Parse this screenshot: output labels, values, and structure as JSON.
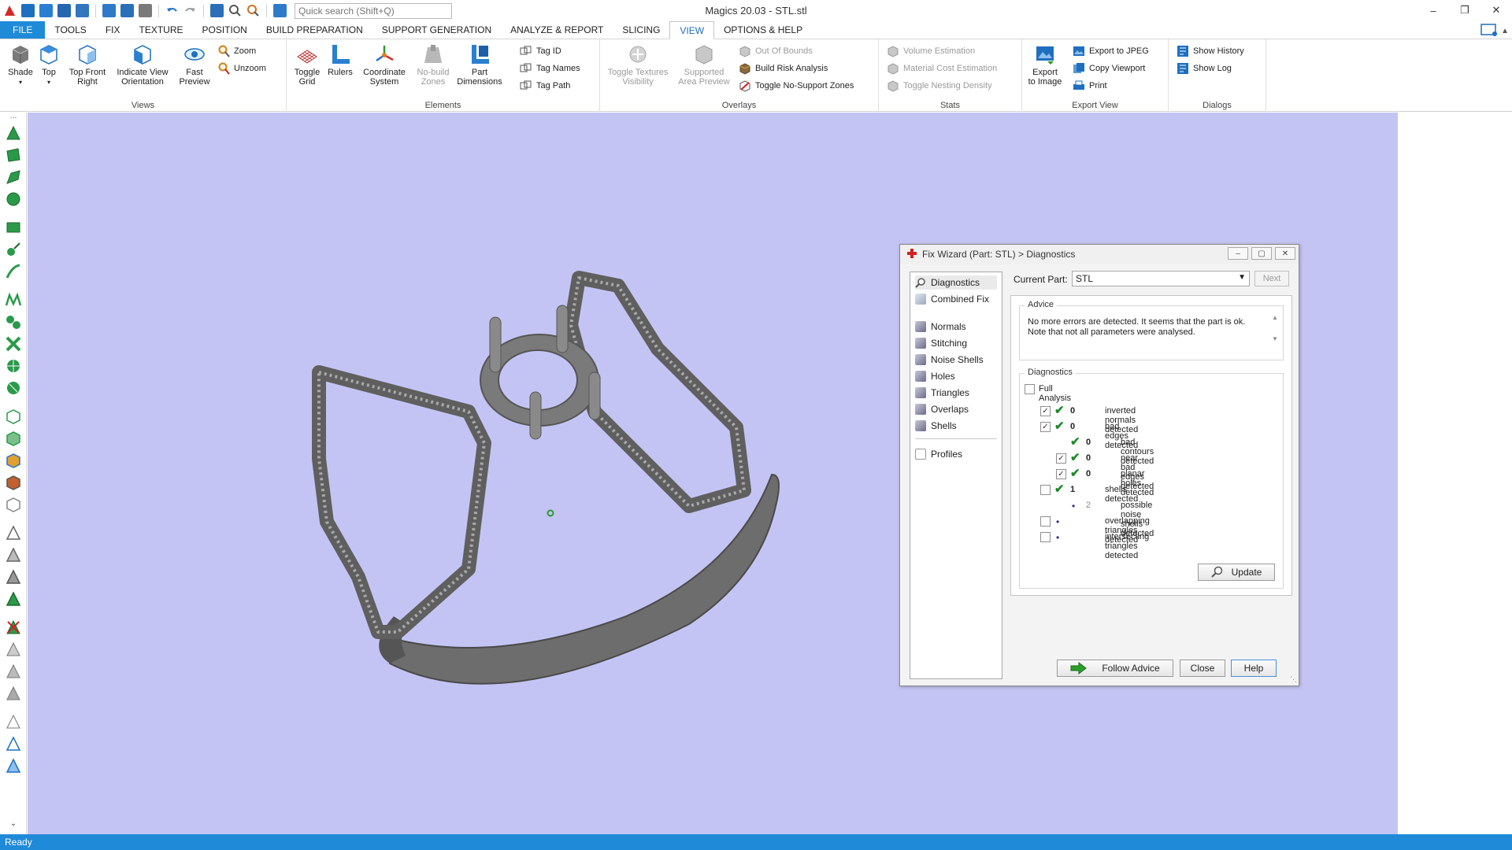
{
  "window": {
    "title": "Magics 20.03 - STL.stl"
  },
  "quick_search": {
    "placeholder": "Quick search (Shift+Q)"
  },
  "menu": {
    "items": [
      "FILE",
      "TOOLS",
      "FIX",
      "TEXTURE",
      "POSITION",
      "BUILD PREPARATION",
      "SUPPORT GENERATION",
      "ANALYZE & REPORT",
      "SLICING",
      "VIEW",
      "OPTIONS & HELP"
    ],
    "active": "VIEW"
  },
  "ribbon": {
    "views": {
      "label": "Views",
      "shade": "Shade",
      "top": "Top",
      "top_front_right": "Top Front\nRight",
      "indicate_view": "Indicate View\nOrientation",
      "fast_preview": "Fast\nPreview",
      "zoom": "Zoom",
      "unzoom": "Unzoom"
    },
    "elements": {
      "label": "Elements",
      "toggle_grid": "Toggle\nGrid",
      "rulers": "Rulers",
      "coordinate_system": "Coordinate\nSystem",
      "no_build_zones": "No-build\nZones",
      "part_dimensions": "Part\nDimensions",
      "tag_id": "Tag ID",
      "tag_names": "Tag Names",
      "tag_path": "Tag Path"
    },
    "overlays": {
      "label": "Overlays",
      "toggle_textures": "Toggle Textures\nVisibility",
      "supported_area": "Supported\nArea Preview",
      "out_of_bounds": "Out Of Bounds",
      "build_risk": "Build Risk Analysis",
      "toggle_no_support": "Toggle No-Support Zones"
    },
    "stats": {
      "label": "Stats",
      "volume": "Volume Estimation",
      "material_cost": "Material Cost Estimation",
      "nesting_density": "Toggle Nesting Density"
    },
    "export_view": {
      "label": "Export View",
      "export_to_image": "Export\nto Image",
      "export_jpeg": "Export to JPEG",
      "copy_viewport": "Copy Viewport",
      "print": "Print"
    },
    "dialogs": {
      "label": "Dialogs",
      "show_history": "Show History",
      "show_log": "Show Log"
    }
  },
  "status": {
    "text": "Ready"
  },
  "fix_wizard": {
    "title": "Fix Wizard (Part: STL) > Diagnostics",
    "nav": [
      "Diagnostics",
      "Combined Fix",
      "Normals",
      "Stitching",
      "Noise Shells",
      "Holes",
      "Triangles",
      "Overlaps",
      "Shells",
      "Profiles"
    ],
    "selected_nav": "Diagnostics",
    "current_part_label": "Current Part:",
    "current_part_value": "STL",
    "next_label": "Next",
    "advice_label": "Advice",
    "advice_text": "No more errors are detected. It seems that the part is ok. Note that not all parameters were analysed.",
    "diagnostics_label": "Diagnostics",
    "full_analysis_label": "Full Analysis",
    "rows": [
      {
        "checked": true,
        "status": "ok",
        "count": "0",
        "label": "inverted normals detected",
        "indent": 0
      },
      {
        "checked": true,
        "status": "ok",
        "count": "0",
        "label": "bad edges detected",
        "indent": 0
      },
      {
        "checked": null,
        "status": "ok",
        "count": "0",
        "label": "bad contours detected",
        "indent": 1
      },
      {
        "checked": true,
        "status": "ok",
        "count": "0",
        "label": "near bad edges detected",
        "indent": 1
      },
      {
        "checked": true,
        "status": "ok",
        "count": "0",
        "label": "planar holes detected",
        "indent": 1
      },
      {
        "checked": false,
        "status": "ok",
        "count": "1",
        "label": "shells detected",
        "indent": 0
      },
      {
        "checked": null,
        "status": "info",
        "count": "2",
        "label": "possible noise shells detected",
        "indent": 1
      },
      {
        "checked": false,
        "status": "info",
        "count": "",
        "label": "overlapping triangles detected",
        "indent": 0
      },
      {
        "checked": false,
        "status": "info",
        "count": "",
        "label": "intersecting triangles detected",
        "indent": 0
      }
    ],
    "update_label": "Update",
    "follow_advice_label": "Follow Advice",
    "close_label": "Close",
    "help_label": "Help"
  }
}
